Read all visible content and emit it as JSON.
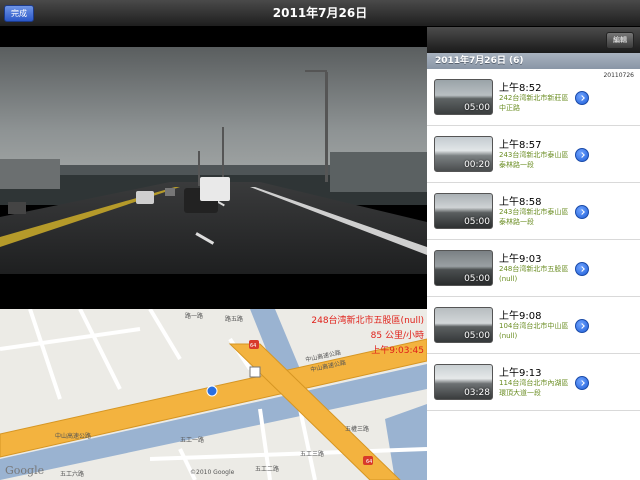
{
  "nav": {
    "done_label": "完成",
    "title": "2011年7月26日"
  },
  "list": {
    "edit_label": "編輯",
    "section_title": "2011年7月26日 (6)",
    "date_code": "20110726",
    "items": [
      {
        "time": "上午8:52",
        "location": "242台湾新北市新莊區中正路",
        "duration": "05:00"
      },
      {
        "time": "上午8:57",
        "location": "243台湾新北市泰山區泰林路一段",
        "duration": "00:20"
      },
      {
        "time": "上午8:58",
        "location": "243台湾新北市泰山區泰林路一段",
        "duration": "05:00"
      },
      {
        "time": "上午9:03",
        "location": "248台湾新北市五股區(null)",
        "duration": "05:00"
      },
      {
        "time": "上午9:08",
        "location": "104台湾台北市中山區(null)",
        "duration": "05:00"
      },
      {
        "time": "上午9:13",
        "location": "114台湾台北市內湖區環頂大道一段",
        "duration": "03:28"
      }
    ]
  },
  "map": {
    "address": "248台湾新北市五股區(null)",
    "speed": "85 公里/小時",
    "time": "上午9:03:45",
    "google": "Google",
    "copyright": "©2010 Google",
    "roads": {
      "zhongshan1": "中山高速公路",
      "zhongshan2": "中山高速公路",
      "zhongshan3": "中山高速公路",
      "wugong1": "五工一路",
      "wugong2": "五工二路",
      "wugong6": "五工六路",
      "wugong3": "五工三路",
      "wuquan3": "五權三路",
      "road1": "路一路",
      "road5": "路五路"
    },
    "shield": "64"
  }
}
